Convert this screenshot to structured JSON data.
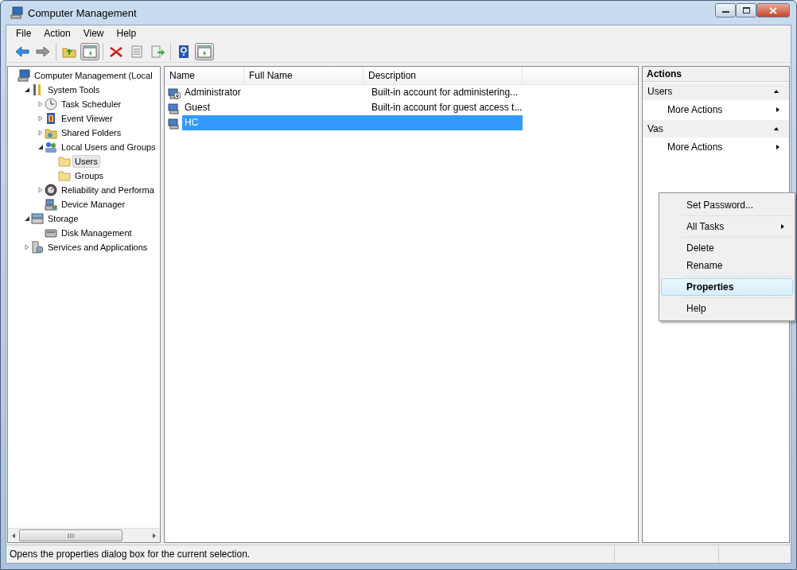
{
  "window": {
    "title": "Computer Management"
  },
  "menu": [
    "File",
    "Action",
    "View",
    "Help"
  ],
  "toolbar": [
    [
      {
        "kind": "back",
        "pressed": false
      },
      {
        "kind": "forward",
        "pressed": false
      }
    ],
    [
      {
        "kind": "up",
        "pressed": false
      },
      {
        "kind": "tree-pane",
        "pressed": true
      }
    ],
    [
      {
        "kind": "delete",
        "pressed": false
      },
      {
        "kind": "properties",
        "pressed": false
      },
      {
        "kind": "export",
        "pressed": false
      }
    ],
    [
      {
        "kind": "help",
        "pressed": false
      },
      {
        "kind": "action-pane",
        "pressed": true
      }
    ]
  ],
  "tree": [
    {
      "label": "Computer Management (Local",
      "kind": "computer",
      "selected": false,
      "children": [
        {
          "label": "System Tools",
          "kind": "tools",
          "expanded": true,
          "selected": false,
          "children": [
            {
              "label": "Task Scheduler",
              "kind": "clock",
              "expanded": false,
              "selected": false
            },
            {
              "label": "Event Viewer",
              "kind": "event",
              "expanded": false,
              "selected": false
            },
            {
              "label": "Shared Folders",
              "kind": "share",
              "expanded": false,
              "selected": false
            },
            {
              "label": "Local Users and Groups",
              "kind": "users",
              "expanded": true,
              "selected": false,
              "children": [
                {
                  "label": "Users",
                  "kind": "folder",
                  "selected": true
                },
                {
                  "label": "Groups",
                  "kind": "folder",
                  "selected": false
                }
              ]
            },
            {
              "label": "Reliability and Performa",
              "kind": "gauge",
              "expanded": false,
              "selected": false
            },
            {
              "label": "Device Manager",
              "kind": "devices",
              "selected": false
            }
          ]
        },
        {
          "label": "Storage",
          "kind": "storage",
          "expanded": true,
          "selected": false,
          "children": [
            {
              "label": "Disk Management",
              "kind": "disk",
              "selected": false
            }
          ]
        },
        {
          "label": "Services and Applications",
          "kind": "services",
          "expanded": false,
          "selected": false
        }
      ]
    }
  ],
  "table": {
    "columns": [
      "Name",
      "Full Name",
      "Description"
    ],
    "rows": [
      {
        "name": "Administrator",
        "kind": "admin",
        "description": "Built-in account for administering...",
        "selected": false
      },
      {
        "name": "Guest",
        "kind": "user",
        "description": "Built-in account for guest access t...",
        "selected": false
      },
      {
        "name": "HC",
        "kind": "user",
        "selected": true
      }
    ]
  },
  "context_menu": [
    [
      {
        "label": "Set Password...",
        "submenu": false,
        "default": false,
        "selected": false
      }
    ],
    [
      {
        "label": "All Tasks",
        "submenu": true,
        "default": false,
        "selected": false
      }
    ],
    [
      {
        "label": "Delete",
        "submenu": false,
        "default": false,
        "selected": false
      },
      {
        "label": "Rename",
        "submenu": false,
        "default": false,
        "selected": false
      }
    ],
    [
      {
        "label": "Properties",
        "submenu": false,
        "default": true,
        "selected": true
      }
    ],
    [
      {
        "label": "Help",
        "submenu": false,
        "default": false,
        "selected": false
      }
    ]
  ],
  "actions": {
    "title": "Actions",
    "sections": [
      {
        "title": "Users",
        "expanded": true,
        "items": [
          {
            "label": "More Actions",
            "submenu": true
          }
        ]
      },
      {
        "title": "Vas",
        "expanded": true,
        "items": [
          {
            "label": "More Actions",
            "submenu": true
          }
        ]
      }
    ]
  },
  "status_bar": {
    "text": "Opens the properties dialog box for the current selection."
  }
}
